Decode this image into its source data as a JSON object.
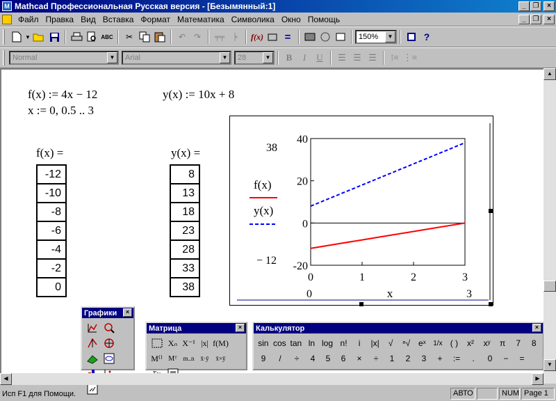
{
  "window": {
    "title": "Mathcad Профессиональная Русская версия - [Безымянный:1]"
  },
  "menu": [
    "Файл",
    "Правка",
    "Вид",
    "Вставка",
    "Формат",
    "Математика",
    "Символика",
    "Окно",
    "Помощь"
  ],
  "toolbar": {
    "zoom": "150%"
  },
  "format_bar": {
    "style": "Normal",
    "font": "Arial",
    "size": "28"
  },
  "worksheet": {
    "f_def": "f(x) := 4x − 12",
    "y_def": "y(x) := 10x + 8",
    "x_range": "x := 0, 0.5 .. 3",
    "f_eval_label": "f(x) =",
    "y_eval_label": "y(x) =",
    "f_values": [
      "-12",
      "-10",
      "-8",
      "-6",
      "-4",
      "-2",
      "0"
    ],
    "y_values": [
      "8",
      "13",
      "18",
      "23",
      "28",
      "33",
      "38"
    ]
  },
  "chart_data": {
    "type": "line",
    "x": [
      0,
      0.5,
      1,
      1.5,
      2,
      2.5,
      3
    ],
    "series": [
      {
        "name": "f(x)",
        "values": [
          -12,
          -10,
          -8,
          -6,
          -4,
          -2,
          0
        ],
        "color": "#ff0000",
        "style": "solid"
      },
      {
        "name": "y(x)",
        "values": [
          8,
          13,
          18,
          23,
          28,
          33,
          38
        ],
        "color": "#0000ff",
        "style": "dashed"
      }
    ],
    "xlabel": "x",
    "ylim": [
      -20,
      40
    ],
    "xlim": [
      0,
      3
    ],
    "yticks": [
      -20,
      0,
      20,
      40
    ],
    "xticks": [
      0,
      1,
      2,
      3
    ],
    "ymax_marker": "38",
    "ymin_marker": "− 12",
    "xmin_marker": "0",
    "xmax_marker": "3",
    "legend": "left",
    "grid": false
  },
  "palettes": {
    "graphs": {
      "title": "Графики"
    },
    "matrix": {
      "title": "Матрица"
    },
    "calculator": {
      "title": "Калькулятор",
      "row1": [
        "sin",
        "cos",
        "tan",
        "ln",
        "log",
        "n!",
        "i",
        "|x|",
        "√",
        "ⁿ√",
        "eˣ",
        "1/x",
        "( )",
        "x²",
        "xʸ",
        "π",
        "7",
        "8"
      ],
      "row2": [
        "9",
        "/",
        "÷",
        "4",
        "5",
        "6",
        "×",
        "÷",
        "1",
        "2",
        "3",
        "+",
        ":=",
        ".",
        "0",
        "−",
        "="
      ]
    }
  },
  "status": {
    "message": "Исп F1 для Помощи.",
    "mode": "АВТО",
    "num": "NUM",
    "page": "Page 1"
  }
}
